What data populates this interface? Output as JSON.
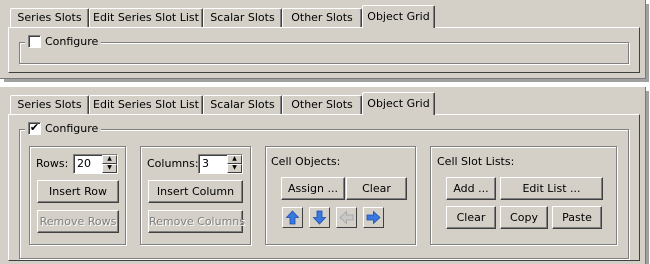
{
  "tabs": [
    {
      "label": "Series Slots"
    },
    {
      "label": "Edit Series Slot List"
    },
    {
      "label": "Scalar Slots"
    },
    {
      "label": "Other Slots"
    },
    {
      "label": "Object Grid"
    }
  ],
  "top_panel": {
    "configure": {
      "label": "Configure",
      "checked": false
    }
  },
  "bottom_panel": {
    "configure": {
      "label": "Configure",
      "checked": true,
      "check_glyph": "✔"
    },
    "rows_group": {
      "label": "Rows:",
      "value": "20",
      "insert_label": "Insert Row",
      "remove_label": "Remove Rows"
    },
    "columns_group": {
      "label": "Columns:",
      "value": "3",
      "insert_label": "Insert Column",
      "remove_label": "Remove Columns"
    },
    "cell_objects": {
      "title": "Cell Objects:",
      "assign_label": "Assign ...",
      "clear_label": "Clear",
      "arrows": [
        {
          "icon": "arrow-up-icon",
          "enabled": true
        },
        {
          "icon": "arrow-down-icon",
          "enabled": true
        },
        {
          "icon": "arrow-left-icon",
          "enabled": false
        },
        {
          "icon": "arrow-right-icon",
          "enabled": true
        }
      ]
    },
    "cell_slot_lists": {
      "title": "Cell Slot Lists:",
      "add_label": "Add ...",
      "edit_label": "Edit List ...",
      "clear_label": "Clear",
      "copy_label": "Copy",
      "paste_label": "Paste"
    }
  },
  "colors": {
    "face": "#d4d0c8",
    "arrow_enabled": "#3a78e0",
    "arrow_disabled": "#a0a0a0"
  }
}
